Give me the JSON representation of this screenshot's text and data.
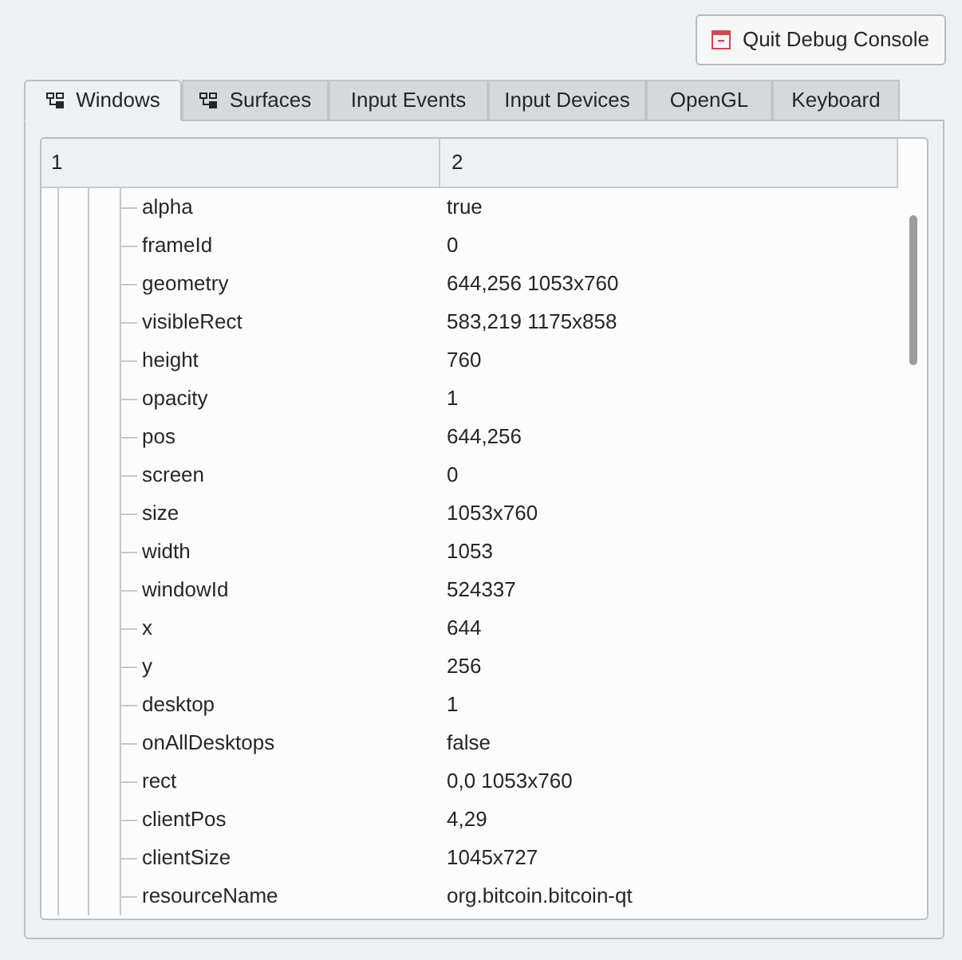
{
  "toolbar": {
    "quit_button": {
      "label": "Quit Debug Console"
    }
  },
  "tabs": [
    {
      "label": "Windows",
      "selected": true,
      "has_icon": true
    },
    {
      "label": "Surfaces",
      "selected": false,
      "has_icon": true
    },
    {
      "label": "Input Events",
      "selected": false,
      "has_icon": false
    },
    {
      "label": "Input Devices",
      "selected": false,
      "has_icon": false
    },
    {
      "label": "OpenGL",
      "selected": false,
      "has_icon": false
    },
    {
      "label": "Keyboard",
      "selected": false,
      "has_icon": false
    }
  ],
  "tree": {
    "columns": [
      "1",
      "2"
    ],
    "rows": [
      {
        "name": "alpha",
        "value": "true"
      },
      {
        "name": "frameId",
        "value": "0"
      },
      {
        "name": "geometry",
        "value": "644,256 1053x760"
      },
      {
        "name": "visibleRect",
        "value": "583,219 1175x858"
      },
      {
        "name": "height",
        "value": "760"
      },
      {
        "name": "opacity",
        "value": "1"
      },
      {
        "name": "pos",
        "value": "644,256"
      },
      {
        "name": "screen",
        "value": "0"
      },
      {
        "name": "size",
        "value": "1053x760"
      },
      {
        "name": "width",
        "value": "1053"
      },
      {
        "name": "windowId",
        "value": "524337"
      },
      {
        "name": "x",
        "value": "644"
      },
      {
        "name": "y",
        "value": "256"
      },
      {
        "name": "desktop",
        "value": "1"
      },
      {
        "name": "onAllDesktops",
        "value": "false"
      },
      {
        "name": "rect",
        "value": "0,0 1053x760"
      },
      {
        "name": "clientPos",
        "value": "4,29"
      },
      {
        "name": "clientSize",
        "value": "1045x727"
      },
      {
        "name": "resourceName",
        "value": "org.bitcoin.bitcoin-qt"
      }
    ]
  }
}
